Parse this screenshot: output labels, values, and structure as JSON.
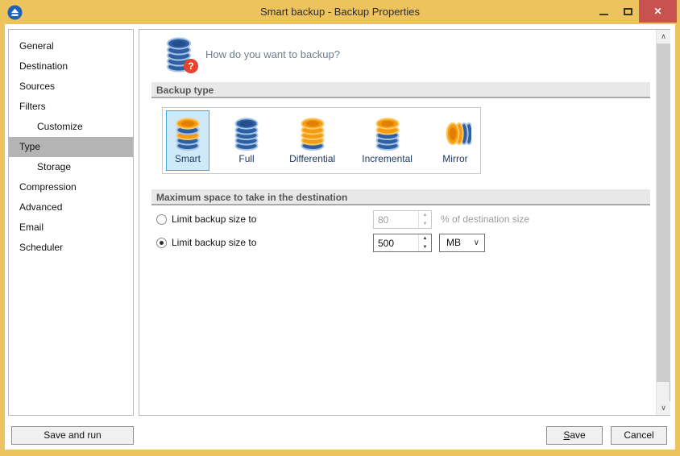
{
  "window": {
    "title": "Smart backup - Backup Properties"
  },
  "sidebar": {
    "items": [
      {
        "label": "General",
        "indent": false,
        "selected": false
      },
      {
        "label": "Destination",
        "indent": false,
        "selected": false
      },
      {
        "label": "Sources",
        "indent": false,
        "selected": false
      },
      {
        "label": "Filters",
        "indent": false,
        "selected": false
      },
      {
        "label": "Customize",
        "indent": true,
        "selected": false
      },
      {
        "label": "Type",
        "indent": false,
        "selected": true
      },
      {
        "label": "Storage",
        "indent": true,
        "selected": false
      },
      {
        "label": "Compression",
        "indent": false,
        "selected": false
      },
      {
        "label": "Advanced",
        "indent": false,
        "selected": false
      },
      {
        "label": "Email",
        "indent": false,
        "selected": false
      },
      {
        "label": "Scheduler",
        "indent": false,
        "selected": false
      }
    ]
  },
  "main": {
    "header_question": "How do you want to backup?",
    "backup_type": {
      "section_title": "Backup type",
      "options": [
        {
          "label": "Smart",
          "selected": true
        },
        {
          "label": "Full",
          "selected": false
        },
        {
          "label": "Differential",
          "selected": false
        },
        {
          "label": "Incremental",
          "selected": false
        },
        {
          "label": "Mirror",
          "selected": false
        }
      ]
    },
    "max_space": {
      "section_title": "Maximum space to take in the destination",
      "row_percent": {
        "label": "Limit backup size to",
        "value": "80",
        "suffix": "% of destination size",
        "selected": false,
        "enabled": false
      },
      "row_size": {
        "label": "Limit backup size to",
        "value": "500",
        "unit": "MB",
        "selected": true,
        "enabled": true
      }
    }
  },
  "footer": {
    "save_and_run": "Save and run",
    "save": "Save",
    "cancel": "Cancel"
  },
  "colors": {
    "titlebar": "#edc35e",
    "close_button": "#c85250",
    "sidebar_selected_bg": "#b4b4b4",
    "selected_tile_bg": "#cfe9f8",
    "selected_tile_border": "#45a5de",
    "accent_orange": "#f49b13",
    "accent_blue": "#2e5fa3"
  }
}
